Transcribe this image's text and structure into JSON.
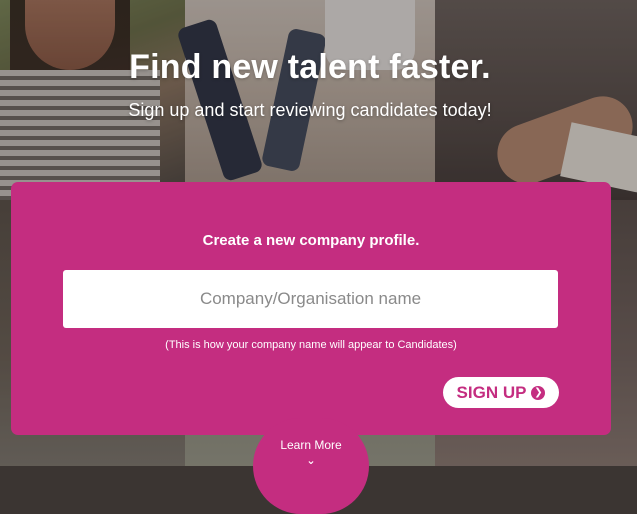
{
  "hero": {
    "title": "Find new talent faster.",
    "subtitle": "Sign up and start reviewing candidates today!"
  },
  "signup_card": {
    "heading": "Create a new company profile.",
    "company_input": {
      "placeholder": "Company/Organisation name",
      "value": ""
    },
    "hint": "(This is how your company name will appear to Candidates)",
    "signup_button_label": "SIGN UP",
    "signup_button_icon": "chevron-right-circle-icon"
  },
  "learn_more": {
    "label": "Learn More",
    "icon": "chevron-down-icon"
  },
  "colors": {
    "brand": "#c42d80",
    "text_on_brand": "#ffffff"
  }
}
